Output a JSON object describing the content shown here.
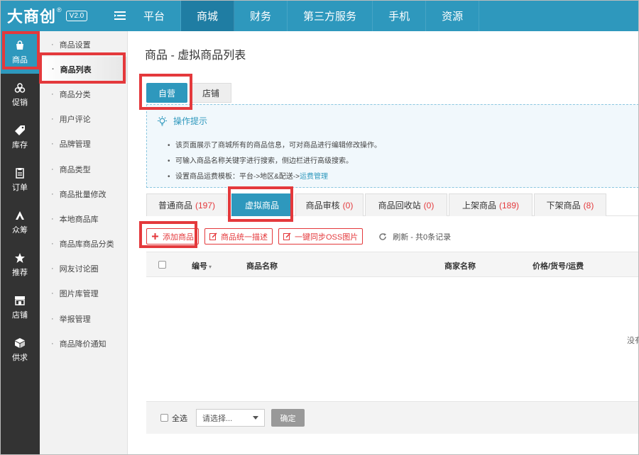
{
  "brand": {
    "logo": "大商创",
    "reg": "®",
    "version": "V2.0"
  },
  "top_nav": [
    {
      "label": "平台",
      "active": false
    },
    {
      "label": "商城",
      "active": true
    },
    {
      "label": "财务",
      "active": false
    },
    {
      "label": "第三方服务",
      "active": false
    },
    {
      "label": "手机",
      "active": false
    },
    {
      "label": "资源",
      "active": false
    }
  ],
  "icon_sidebar": [
    {
      "label": "商品",
      "icon": "shopping-bag-icon",
      "active": true
    },
    {
      "label": "促销",
      "icon": "promotion-icon"
    },
    {
      "label": "库存",
      "icon": "tag-icon"
    },
    {
      "label": "订单",
      "icon": "order-icon"
    },
    {
      "label": "众筹",
      "icon": "crowdfund-icon"
    },
    {
      "label": "推荐",
      "icon": "star-icon"
    },
    {
      "label": "店铺",
      "icon": "store-icon"
    },
    {
      "label": "供求",
      "icon": "cube-icon"
    }
  ],
  "submenu": [
    {
      "label": "商品设置"
    },
    {
      "label": "商品列表",
      "active": true
    },
    {
      "label": "商品分类"
    },
    {
      "label": "用户评论"
    },
    {
      "label": "品牌管理"
    },
    {
      "label": "商品类型"
    },
    {
      "label": "商品批量修改"
    },
    {
      "label": "本地商品库"
    },
    {
      "label": "商品库商品分类"
    },
    {
      "label": "网友讨论圈"
    },
    {
      "label": "图片库管理"
    },
    {
      "label": "举报管理"
    },
    {
      "label": "商品降价通知"
    }
  ],
  "page": {
    "title": "商品 - 虚拟商品列表"
  },
  "scope_tabs": [
    {
      "label": "自营",
      "active": true
    },
    {
      "label": "店铺",
      "active": false
    }
  ],
  "tips": {
    "title": "操作提示",
    "items": [
      "该页面展示了商城所有的商品信息，可对商品进行编辑修改操作。",
      "可输入商品名称关键字进行搜索，侧边栏进行高级搜索。",
      "设置商品运费模板：平台->地区&配送->"
    ],
    "link": "运费管理"
  },
  "type_tabs": [
    {
      "label": "普通商品",
      "count": "(197)"
    },
    {
      "label": "虚拟商品",
      "count": "",
      "active": true
    },
    {
      "label": "商品审核",
      "count": "(0)"
    },
    {
      "label": "商品回收站",
      "count": "(0)"
    },
    {
      "label": "上架商品",
      "count": "(189)"
    },
    {
      "label": "下架商品",
      "count": "(8)"
    }
  ],
  "actions": {
    "add": "添加商品",
    "describe": "商品统一描述",
    "sync": "一键同步OSS图片",
    "refresh": "刷新 - 共0条记录"
  },
  "table": {
    "columns": [
      "编号",
      "商品名称",
      "商家名称",
      "价格/货号/运费"
    ],
    "empty": "没有"
  },
  "footer": {
    "select_all": "全选",
    "select_placeholder": "请选择...",
    "confirm": "确定"
  },
  "colors": {
    "primary": "#2e98bd",
    "sidebar": "#333333",
    "highlight": "#e4393c"
  }
}
